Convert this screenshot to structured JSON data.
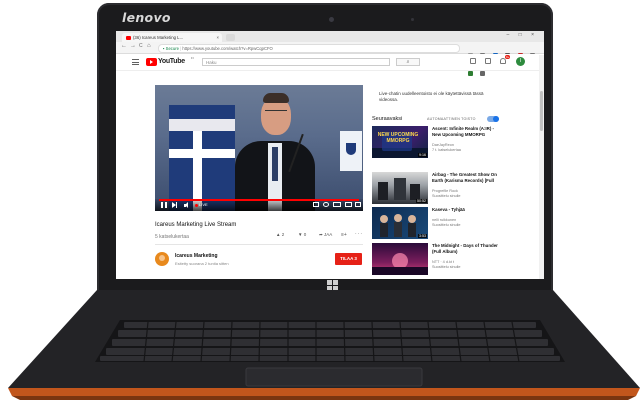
{
  "laptop": {
    "brand": "lenovo"
  },
  "browser": {
    "tab_title": "(36) Icareus Marketing L...",
    "tab_close": "×",
    "window_controls": "–  □  ×",
    "nav_back": "←",
    "nav_forward": "→",
    "nav_reload": "C",
    "nav_home": "⌂",
    "secure_label": "Secure",
    "url": "https://www.youtube.com/watch?v=RpwCqpCFO"
  },
  "youtube": {
    "logo_text": "YouTube",
    "logo_country": "FI",
    "search_placeholder": "Haku",
    "search_icon": "⌕",
    "notification_count": "9+",
    "avatar_letter": "I",
    "video": {
      "title": "Icareus Marketing Live Stream",
      "views": "5 katselukertaa",
      "likes": "2",
      "dislikes": "0",
      "share_label": "JAA",
      "add_icon": "≡+",
      "more_icon": "···",
      "live_label": "LIVE",
      "progress_fraction": 1.0
    },
    "channel": {
      "name": "Icareus Marketing",
      "subtitle": "Esitetty suorana 2 tuntia sitten",
      "subscribe_label": "TILAA 3"
    },
    "sidebar": {
      "live_chat_note": "Live-chatin uudelleentoisto ei ole käytettävissä tässä videossa.",
      "up_next_label": "Seuraavaksi",
      "autoplay_label": "AUTOMAATTINEN TOISTO",
      "autoplay_on": true,
      "items": [
        {
          "title": "Ascent: Infinite Realm (A:IR) - New Upcoming MMORPG",
          "channel": "DaeJayReon",
          "meta": "7 t. katselukertaa",
          "duration": "9:16",
          "thumb_text": "NEW UPCOMING MMORPG"
        },
        {
          "title": "Airbag - The Greatest Show On Earth (Karisma Records) [Full",
          "channel": "Progrefile Rock",
          "meta": "Suosittelu sinulle",
          "duration": "50:52",
          "thumb_text": ""
        },
        {
          "title": "Kaseva - Tyhjää",
          "channel": "nelli ruikkunen",
          "meta": "Suosittelu sinulle",
          "duration": "3:53",
          "thumb_text": ""
        },
        {
          "title": "The Midnight - Days of Thunder (Full Album)",
          "channel": "NTT · 4 d.kt t",
          "meta": "Suosittelu sinulle",
          "duration": "",
          "thumb_text": ""
        }
      ]
    }
  },
  "colors": {
    "yt_red": "#ff0000",
    "subscribe_red": "#e62117",
    "toggle_blue": "#1a73e8",
    "laptop_black": "#1b1b1d",
    "laptop_orange_edge": "#c2561c"
  }
}
